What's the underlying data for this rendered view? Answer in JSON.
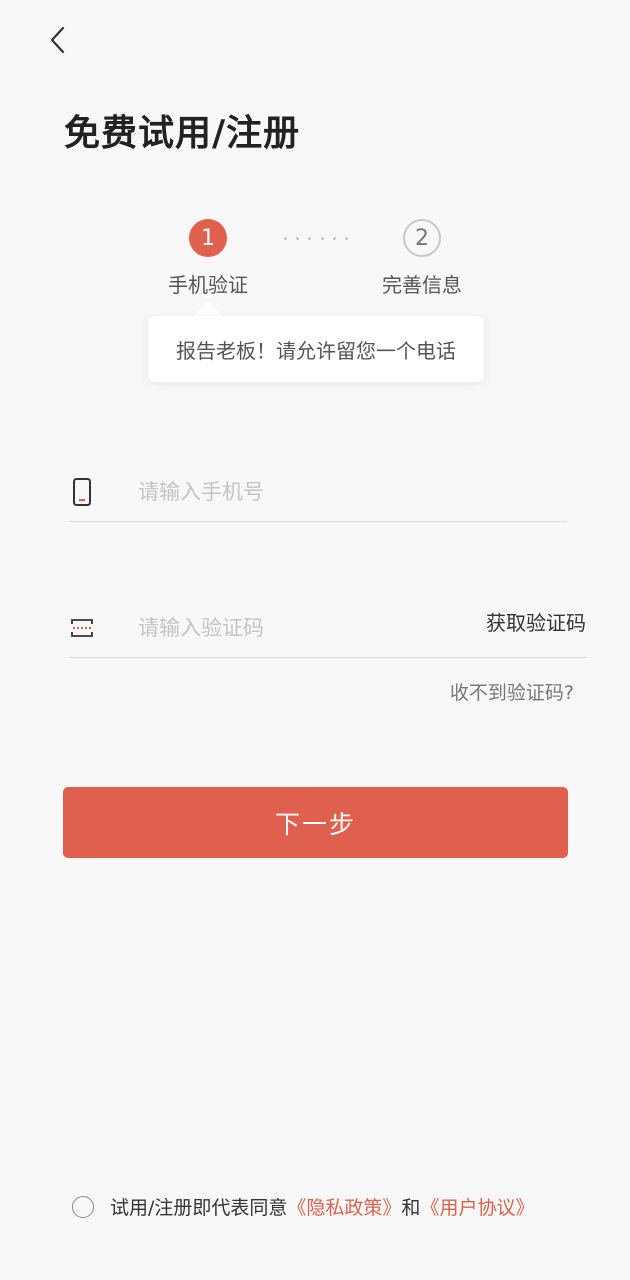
{
  "icons": {
    "back": "chevron-left-icon",
    "phone": "phone-icon",
    "code": "code-scan-icon"
  },
  "colors": {
    "accent": "#e0604f",
    "background": "#f8f8f8"
  },
  "page_title": "免费试用/注册",
  "steps": [
    {
      "number": "1",
      "label": "手机验证",
      "active": true
    },
    {
      "number": "2",
      "label": "完善信息",
      "active": false
    }
  ],
  "tooltip": "报告老板！请允许留您一个电话",
  "phone_field": {
    "placeholder": "请输入手机号",
    "value": ""
  },
  "code_field": {
    "placeholder": "请输入验证码",
    "value": ""
  },
  "get_code_label": "获取验证码",
  "no_code_label": "收不到验证码?",
  "next_button_label": "下一步",
  "agreement": {
    "prefix": "试用/注册即代表同意",
    "privacy_link": "《隐私政策》",
    "conjunction": "和",
    "terms_link": "《用户协议》"
  }
}
